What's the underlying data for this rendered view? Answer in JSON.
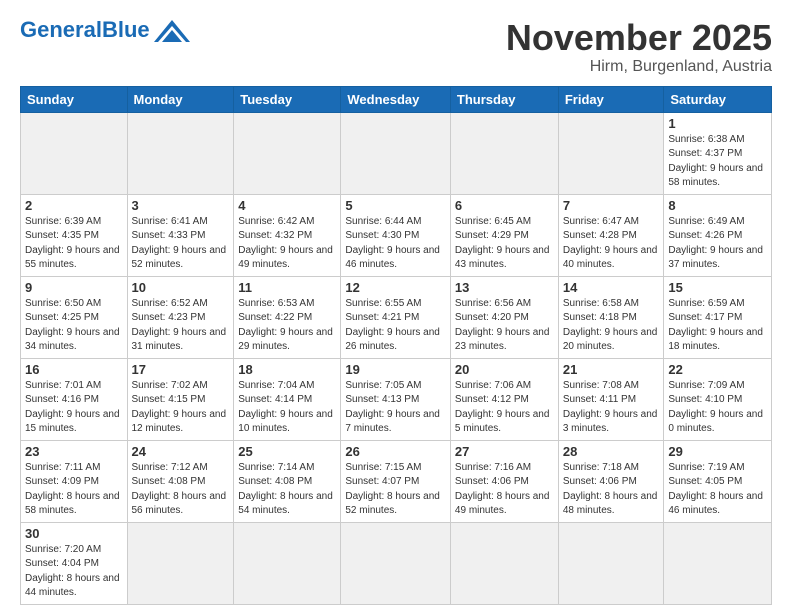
{
  "logo": {
    "text_general": "General",
    "text_blue": "Blue"
  },
  "title": {
    "month_year": "November 2025",
    "location": "Hirm, Burgenland, Austria"
  },
  "weekdays": [
    "Sunday",
    "Monday",
    "Tuesday",
    "Wednesday",
    "Thursday",
    "Friday",
    "Saturday"
  ],
  "weeks": [
    [
      {
        "day": "",
        "info": "",
        "empty": true
      },
      {
        "day": "",
        "info": "",
        "empty": true
      },
      {
        "day": "",
        "info": "",
        "empty": true
      },
      {
        "day": "",
        "info": "",
        "empty": true
      },
      {
        "day": "",
        "info": "",
        "empty": true
      },
      {
        "day": "",
        "info": "",
        "empty": true
      },
      {
        "day": "1",
        "info": "Sunrise: 6:38 AM\nSunset: 4:37 PM\nDaylight: 9 hours\nand 58 minutes.",
        "empty": false
      }
    ],
    [
      {
        "day": "2",
        "info": "Sunrise: 6:39 AM\nSunset: 4:35 PM\nDaylight: 9 hours\nand 55 minutes.",
        "empty": false
      },
      {
        "day": "3",
        "info": "Sunrise: 6:41 AM\nSunset: 4:33 PM\nDaylight: 9 hours\nand 52 minutes.",
        "empty": false
      },
      {
        "day": "4",
        "info": "Sunrise: 6:42 AM\nSunset: 4:32 PM\nDaylight: 9 hours\nand 49 minutes.",
        "empty": false
      },
      {
        "day": "5",
        "info": "Sunrise: 6:44 AM\nSunset: 4:30 PM\nDaylight: 9 hours\nand 46 minutes.",
        "empty": false
      },
      {
        "day": "6",
        "info": "Sunrise: 6:45 AM\nSunset: 4:29 PM\nDaylight: 9 hours\nand 43 minutes.",
        "empty": false
      },
      {
        "day": "7",
        "info": "Sunrise: 6:47 AM\nSunset: 4:28 PM\nDaylight: 9 hours\nand 40 minutes.",
        "empty": false
      },
      {
        "day": "8",
        "info": "Sunrise: 6:49 AM\nSunset: 4:26 PM\nDaylight: 9 hours\nand 37 minutes.",
        "empty": false
      }
    ],
    [
      {
        "day": "9",
        "info": "Sunrise: 6:50 AM\nSunset: 4:25 PM\nDaylight: 9 hours\nand 34 minutes.",
        "empty": false
      },
      {
        "day": "10",
        "info": "Sunrise: 6:52 AM\nSunset: 4:23 PM\nDaylight: 9 hours\nand 31 minutes.",
        "empty": false
      },
      {
        "day": "11",
        "info": "Sunrise: 6:53 AM\nSunset: 4:22 PM\nDaylight: 9 hours\nand 29 minutes.",
        "empty": false
      },
      {
        "day": "12",
        "info": "Sunrise: 6:55 AM\nSunset: 4:21 PM\nDaylight: 9 hours\nand 26 minutes.",
        "empty": false
      },
      {
        "day": "13",
        "info": "Sunrise: 6:56 AM\nSunset: 4:20 PM\nDaylight: 9 hours\nand 23 minutes.",
        "empty": false
      },
      {
        "day": "14",
        "info": "Sunrise: 6:58 AM\nSunset: 4:18 PM\nDaylight: 9 hours\nand 20 minutes.",
        "empty": false
      },
      {
        "day": "15",
        "info": "Sunrise: 6:59 AM\nSunset: 4:17 PM\nDaylight: 9 hours\nand 18 minutes.",
        "empty": false
      }
    ],
    [
      {
        "day": "16",
        "info": "Sunrise: 7:01 AM\nSunset: 4:16 PM\nDaylight: 9 hours\nand 15 minutes.",
        "empty": false
      },
      {
        "day": "17",
        "info": "Sunrise: 7:02 AM\nSunset: 4:15 PM\nDaylight: 9 hours\nand 12 minutes.",
        "empty": false
      },
      {
        "day": "18",
        "info": "Sunrise: 7:04 AM\nSunset: 4:14 PM\nDaylight: 9 hours\nand 10 minutes.",
        "empty": false
      },
      {
        "day": "19",
        "info": "Sunrise: 7:05 AM\nSunset: 4:13 PM\nDaylight: 9 hours\nand 7 minutes.",
        "empty": false
      },
      {
        "day": "20",
        "info": "Sunrise: 7:06 AM\nSunset: 4:12 PM\nDaylight: 9 hours\nand 5 minutes.",
        "empty": false
      },
      {
        "day": "21",
        "info": "Sunrise: 7:08 AM\nSunset: 4:11 PM\nDaylight: 9 hours\nand 3 minutes.",
        "empty": false
      },
      {
        "day": "22",
        "info": "Sunrise: 7:09 AM\nSunset: 4:10 PM\nDaylight: 9 hours\nand 0 minutes.",
        "empty": false
      }
    ],
    [
      {
        "day": "23",
        "info": "Sunrise: 7:11 AM\nSunset: 4:09 PM\nDaylight: 8 hours\nand 58 minutes.",
        "empty": false
      },
      {
        "day": "24",
        "info": "Sunrise: 7:12 AM\nSunset: 4:08 PM\nDaylight: 8 hours\nand 56 minutes.",
        "empty": false
      },
      {
        "day": "25",
        "info": "Sunrise: 7:14 AM\nSunset: 4:08 PM\nDaylight: 8 hours\nand 54 minutes.",
        "empty": false
      },
      {
        "day": "26",
        "info": "Sunrise: 7:15 AM\nSunset: 4:07 PM\nDaylight: 8 hours\nand 52 minutes.",
        "empty": false
      },
      {
        "day": "27",
        "info": "Sunrise: 7:16 AM\nSunset: 4:06 PM\nDaylight: 8 hours\nand 49 minutes.",
        "empty": false
      },
      {
        "day": "28",
        "info": "Sunrise: 7:18 AM\nSunset: 4:06 PM\nDaylight: 8 hours\nand 48 minutes.",
        "empty": false
      },
      {
        "day": "29",
        "info": "Sunrise: 7:19 AM\nSunset: 4:05 PM\nDaylight: 8 hours\nand 46 minutes.",
        "empty": false
      }
    ],
    [
      {
        "day": "30",
        "info": "Sunrise: 7:20 AM\nSunset: 4:04 PM\nDaylight: 8 hours\nand 44 minutes.",
        "empty": false
      },
      {
        "day": "",
        "info": "",
        "empty": true
      },
      {
        "day": "",
        "info": "",
        "empty": true
      },
      {
        "day": "",
        "info": "",
        "empty": true
      },
      {
        "day": "",
        "info": "",
        "empty": true
      },
      {
        "day": "",
        "info": "",
        "empty": true
      },
      {
        "day": "",
        "info": "",
        "empty": true
      }
    ]
  ]
}
